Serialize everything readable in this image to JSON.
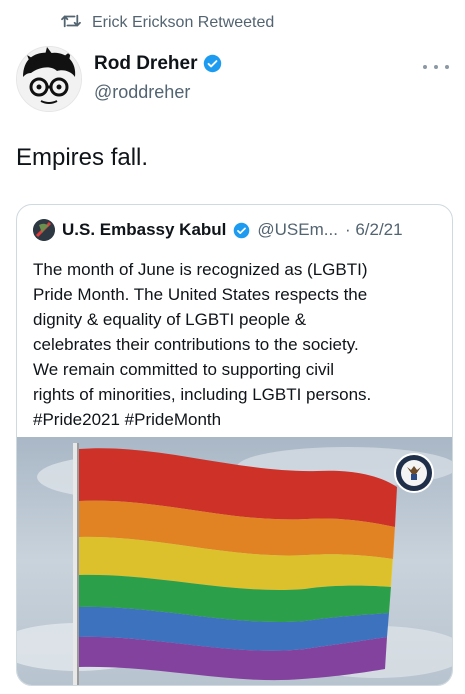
{
  "retweet": {
    "label": "Erick Erickson Retweeted",
    "icon": "retweet-icon"
  },
  "tweet": {
    "author_name": "Rod Dreher",
    "author_handle": "@roddreher",
    "verified": true,
    "text": "Empires fall."
  },
  "quote": {
    "author_name": "U.S. Embassy Kabul",
    "author_handle": "@USEm...",
    "date": "· 6/2/21",
    "verified": true,
    "text_lines": [
      "The month of June is recognized as (LGBTI)",
      "Pride Month. The United States respects the",
      "dignity & equality of LGBTI people &",
      "celebrates their contributions to the society.",
      "We remain committed to supporting civil",
      "rights of minorities, including LGBTI persons.",
      "#Pride2021 #PrideMonth"
    ]
  },
  "colors": {
    "text_primary": "#0f1419",
    "text_secondary": "#536471",
    "verified_blue": "#1d9bf0",
    "card_border": "#cfd9de",
    "flag_stripes": [
      "#d9342b",
      "#f08a24",
      "#f2d22e",
      "#2fa84f",
      "#3f74c9",
      "#8a3fa5"
    ]
  }
}
